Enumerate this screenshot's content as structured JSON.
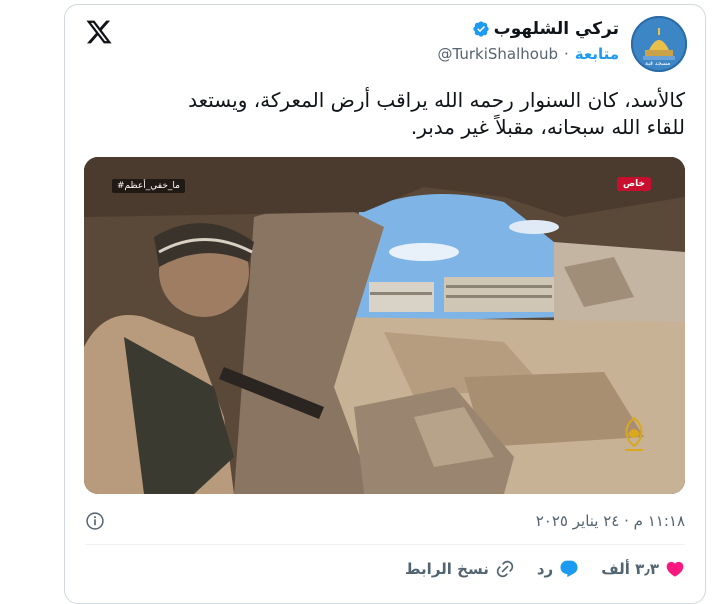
{
  "tweet": {
    "display_name": "تركي الشلهوب",
    "handle": "@TurkiShalhoub",
    "separator": "·",
    "follow_label": "متابعة",
    "text_line1": "كالأسد، كان السنوار رحمه الله يراقب أرض المعركة، ويستعد",
    "text_line2": "للقاء الله سبحانه، مقبلاً غير مدبر.",
    "avatar_caption": "مسجد قبة",
    "timestamp": "١١:١٨ م · ٢٤ يناير ٢٠٢٥"
  },
  "media": {
    "tag_left": "#ما_خفي_أعظم",
    "tag_right": "خاص",
    "logo_text": "الجزيرة"
  },
  "actions": {
    "likes": "٣٫٣ ألف",
    "reply": "رد",
    "copy_link": "نسخ الرابط"
  },
  "colors": {
    "like": "#f91880",
    "reply": "#1d9bf0",
    "follow": "#1d9bf0",
    "verified": "#1d9bf0",
    "muted": "#536471"
  }
}
